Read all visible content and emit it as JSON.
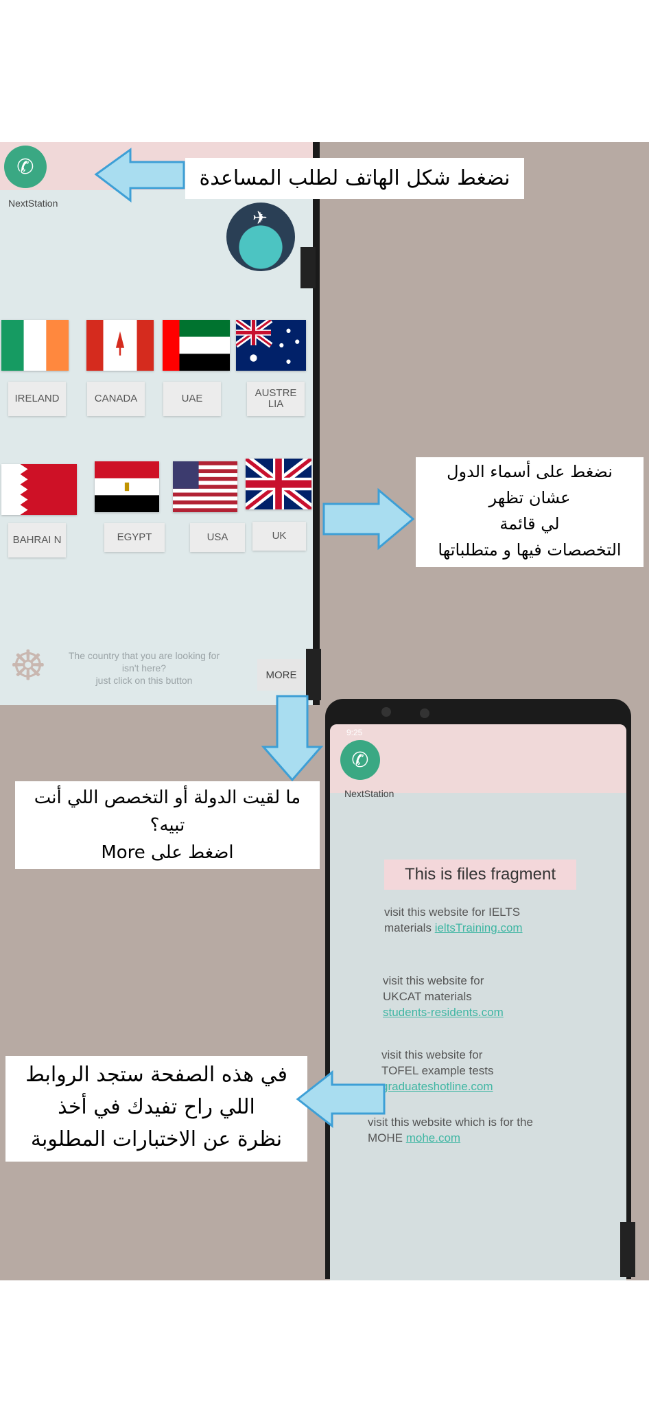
{
  "screen1": {
    "app_name": "NextStation",
    "call_icon": "phone-icon",
    "countries_row1": [
      "IRELAND",
      "CANADA",
      "UAE",
      "AUSTRE LIA"
    ],
    "countries_row2": [
      "BAHRAI N",
      "EGYPT",
      "USA",
      "UK"
    ],
    "hint_line1": "The country that you are looking for",
    "hint_line2": "isn't here?",
    "hint_line3": "just click on this button",
    "more_label": "MORE"
  },
  "screen2": {
    "status_time": "9:25",
    "app_name": "NextStation",
    "title": "This is files fragment",
    "links": [
      {
        "text_line1": "visit this website for IELTS",
        "text_line2": "materials",
        "link": "ieltsTraining.com"
      },
      {
        "text_line1": "visit this website for",
        "text_line2": "UKCAT materials",
        "link": "students-residents.com"
      },
      {
        "text_line1": "visit this website for",
        "text_line2": "TOFEL example tests",
        "link": "graduateshotline.com"
      },
      {
        "text_line1": "visit this website which is for the",
        "text_line2": "MOHE",
        "link": "mohe.com"
      }
    ]
  },
  "notes": {
    "call_note": "نضغط شكل الهاتف لطلب المساعدة",
    "countries_note_line1": "نضغط على أسماء الدول",
    "countries_note_line2": "عشان تظهر",
    "countries_note_line3": "لي قائمة",
    "countries_note_line4": "التخصصات فيها و متطلباتها",
    "more_note_line1": "ما لقيت الدولة أو التخصص اللي أنت",
    "more_note_line2": "تبيه؟",
    "more_note_line3": "اضغط على More",
    "links_note_line1": "في هذه الصفحة ستجد الروابط",
    "links_note_line2": "اللي راح تفيدك في أخذ",
    "links_note_line3": "نظرة عن الاختبارات المطلوبة"
  },
  "colors": {
    "call_button": "#3aa883",
    "arrow_fill": "#a9ddf0",
    "arrow_stroke": "#3d9fd6",
    "link": "#3fb6a3"
  }
}
